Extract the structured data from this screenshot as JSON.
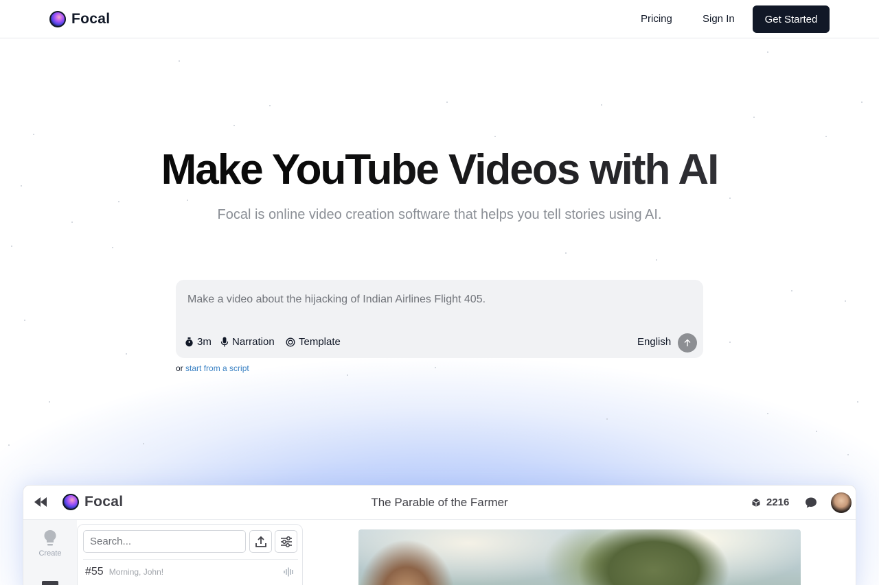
{
  "nav": {
    "brand": "Focal",
    "links": [
      "Pricing",
      "Sign In"
    ],
    "cta": "Get Started"
  },
  "hero": {
    "title": "Make YouTube Videos with AI",
    "subtitle": "Focal is online video creation software that helps you tell stories using AI."
  },
  "prompt": {
    "placeholder": "Make a video about the hijacking of Indian Airlines Flight 405.",
    "options": {
      "duration": "3m",
      "narration": "Narration",
      "template": "Template",
      "language": "English"
    },
    "alt_prefix": "or",
    "alt_link": "start from a script"
  },
  "app_preview": {
    "brand": "Focal",
    "project_title": "The Parable of the Farmer",
    "credits": "2216",
    "sidebar": {
      "create_label": "Create"
    },
    "search_placeholder": "Search...",
    "list": [
      {
        "number": "#55",
        "label": "Morning, John!"
      }
    ]
  },
  "colors": {
    "cta_bg": "#111827",
    "link": "#3b82c4",
    "glow": "#aec5fb"
  },
  "icons": [
    "stopwatch-icon",
    "microphone-icon",
    "template-icon",
    "arrow-up-icon",
    "rewind-icon",
    "cube-icon",
    "chat-bubble-icon",
    "lightbulb-icon",
    "upload-icon",
    "sliders-icon",
    "waveform-icon"
  ]
}
